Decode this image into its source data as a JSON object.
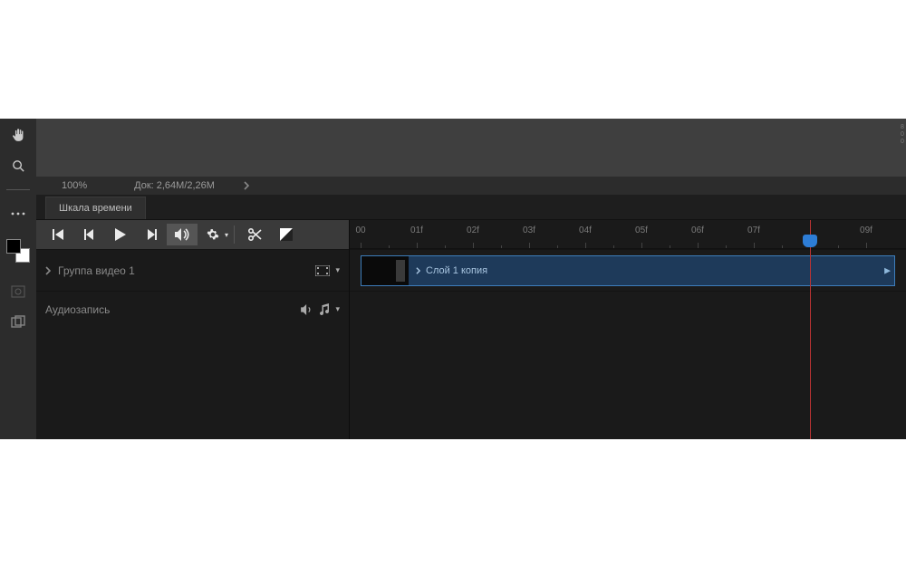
{
  "canvas_ruler_marks": [
    "8",
    "0",
    "0"
  ],
  "infobar": {
    "zoom": "100%",
    "doc": "Док: 2,64M/2,26M"
  },
  "tab": {
    "label": "Шкала времени"
  },
  "group_row": {
    "name": "Группа видео 1"
  },
  "audio_row": {
    "name": "Аудиозапись"
  },
  "clip": {
    "label": "Слой 1 копия"
  },
  "ruler_labels": [
    "00",
    "01f",
    "02f",
    "03f",
    "04f",
    "05f",
    "06f",
    "07f",
    "09f"
  ],
  "playhead_frame": 8
}
